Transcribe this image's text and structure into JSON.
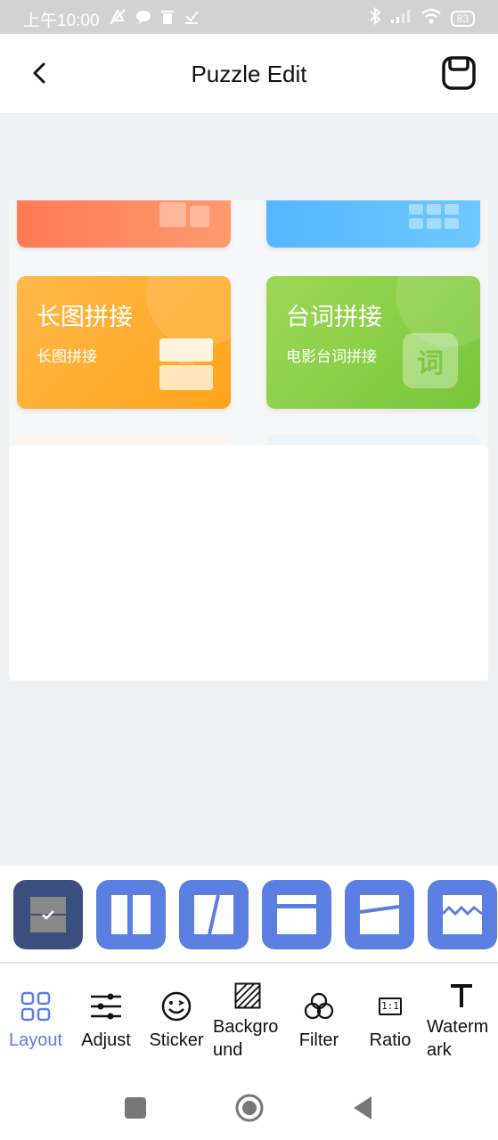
{
  "status_bar": {
    "time": "上午10:00",
    "battery": "83",
    "icons_left": [
      "mute-icon",
      "chat-icon",
      "trash-icon",
      "download-icon"
    ],
    "icons_right": [
      "bluetooth-icon",
      "signal-icon",
      "wifi-icon",
      "battery-icon"
    ]
  },
  "header": {
    "title": "Puzzle Edit",
    "back_icon": "chevron-left-icon",
    "save_icon": "save-icon"
  },
  "canvas_cards": [
    {
      "title": "长图拼接",
      "subtitle": "长图拼接",
      "color_from": "#ffb43c",
      "color_to": "#ffa21e",
      "icon": "stack-icon"
    },
    {
      "title": "台词拼接",
      "subtitle": "电影台词拼接",
      "color_from": "#9bd651",
      "color_to": "#78c83c",
      "icon": "ci-icon",
      "icon_text": "词"
    }
  ],
  "layouts": [
    {
      "name": "two-horizontal",
      "selected": true
    },
    {
      "name": "two-vertical",
      "selected": false
    },
    {
      "name": "diagonal",
      "selected": false
    },
    {
      "name": "top-band",
      "selected": false
    },
    {
      "name": "slanted",
      "selected": false
    },
    {
      "name": "wave",
      "selected": false
    }
  ],
  "toolbar": {
    "layout": "Layout",
    "adjust": "Adjust",
    "sticker": "Sticker",
    "background": "Backgro\nund",
    "filter": "Filter",
    "ratio": "Ratio",
    "ratio_icon_text": "1:1",
    "watermark": "Waterm\nark"
  },
  "colors": {
    "accent": "#5b7fe0",
    "selected_layout": "#3b4f7e",
    "coral_card": "#ff7f5a",
    "blue_card": "#5ebcff"
  }
}
